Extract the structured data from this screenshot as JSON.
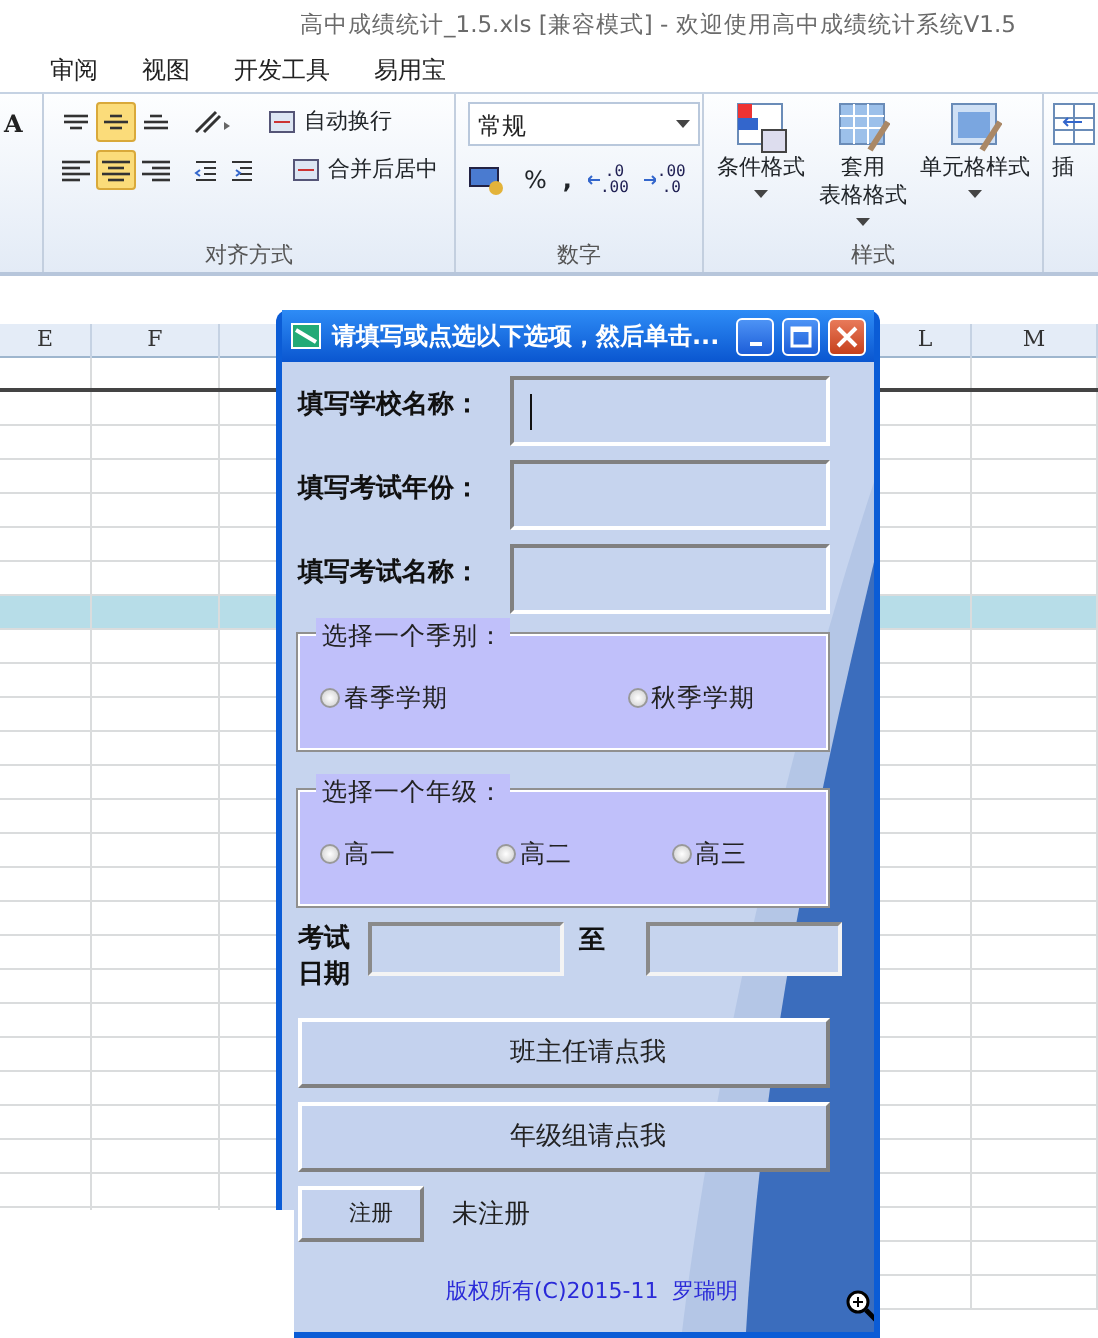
{
  "app_title": "高中成绩统计_1.5.xls  [兼容模式]  -  欢迎使用高中成绩统计系统V1.5",
  "menu_tabs": [
    "审阅",
    "视图",
    "开发工具",
    "易用宝"
  ],
  "ribbon": {
    "font_glyph": "A",
    "alignment": {
      "title": "对齐方式",
      "wrap_text": "自动换行",
      "merge_center": "合并后居中",
      "vertical": [
        {
          "kind": "top",
          "selected": false
        },
        {
          "kind": "middle",
          "selected": true
        },
        {
          "kind": "bottom",
          "selected": false
        }
      ],
      "horizontal": [
        {
          "kind": "left",
          "selected": false
        },
        {
          "kind": "center",
          "selected": true
        },
        {
          "kind": "right",
          "selected": false
        }
      ]
    },
    "number": {
      "title": "数字",
      "format": "常规",
      "percent": "%",
      "comma": ",",
      "increase_decimal": [
        ".0",
        ".00"
      ],
      "decrease_decimal": [
        ".00",
        ".0"
      ]
    },
    "styles": {
      "title": "样式",
      "buttons": [
        {
          "kind": "conditional",
          "lines": [
            "条件格式"
          ]
        },
        {
          "kind": "table",
          "lines": [
            "套用",
            "表格格式"
          ]
        },
        {
          "kind": "cell",
          "lines": [
            "单元格样式"
          ]
        }
      ]
    },
    "insert": {
      "label": "插"
    }
  },
  "sheet": {
    "columns_left": [
      "E",
      "F"
    ],
    "columns_right": [
      "L",
      "M"
    ]
  },
  "dialog": {
    "title": "请填写或点选以下选项，然后单击...",
    "fields": [
      {
        "label": "填写学校名称：",
        "focused": true
      },
      {
        "label": "填写考试年份：",
        "focused": false
      },
      {
        "label": "填写考试名称：",
        "focused": false
      }
    ],
    "season": {
      "legend": "选择一个季别：",
      "options": [
        {
          "label": "春季学期",
          "selected": false
        },
        {
          "label": "秋季学期",
          "selected": false
        }
      ]
    },
    "grade": {
      "legend": "选择一个年级：",
      "options": [
        {
          "label": "高一",
          "selected": false
        },
        {
          "label": "高二",
          "selected": false
        },
        {
          "label": "高三",
          "selected": false
        }
      ]
    },
    "date": {
      "label": "考试日期",
      "separator": "至"
    },
    "buttons": [
      "班主任请点我",
      "年级组请点我"
    ],
    "register_button": "注册",
    "register_status": "未注册",
    "footer": "版权所有(C)2015-11  罗瑞明"
  }
}
